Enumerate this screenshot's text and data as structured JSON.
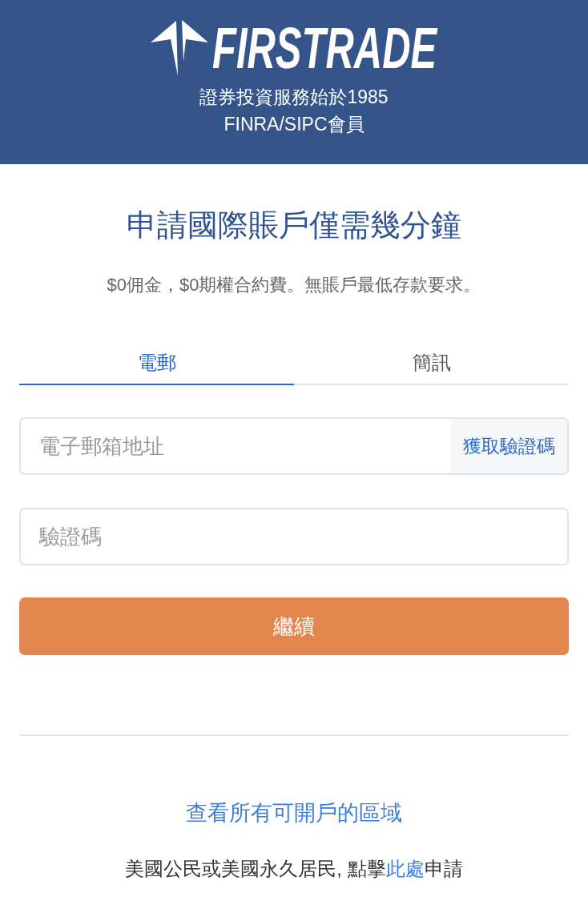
{
  "header": {
    "logo_text": "FIRSTRADE",
    "taglines": [
      "證券投資服務始於1985",
      "FINRA/SIPC會員"
    ]
  },
  "title": "申請國際賬戶僅需幾分鐘",
  "subtitle": "$0佣金，$0期權合約費。無賬戶最低存款要求。",
  "tabs": [
    {
      "label": "電郵",
      "selected": true
    },
    {
      "label": "簡訊",
      "selected": false
    }
  ],
  "email_field": {
    "placeholder": "電子郵箱地址",
    "button": "獲取驗證碼"
  },
  "code_field": {
    "placeholder": "驗證碼"
  },
  "continue_button": "繼續",
  "regions_link": "查看所有可開戶的區域",
  "footer_note": {
    "before": "美國公民或美國永久居民, 點擊",
    "link": "此處",
    "after": "申請"
  }
}
